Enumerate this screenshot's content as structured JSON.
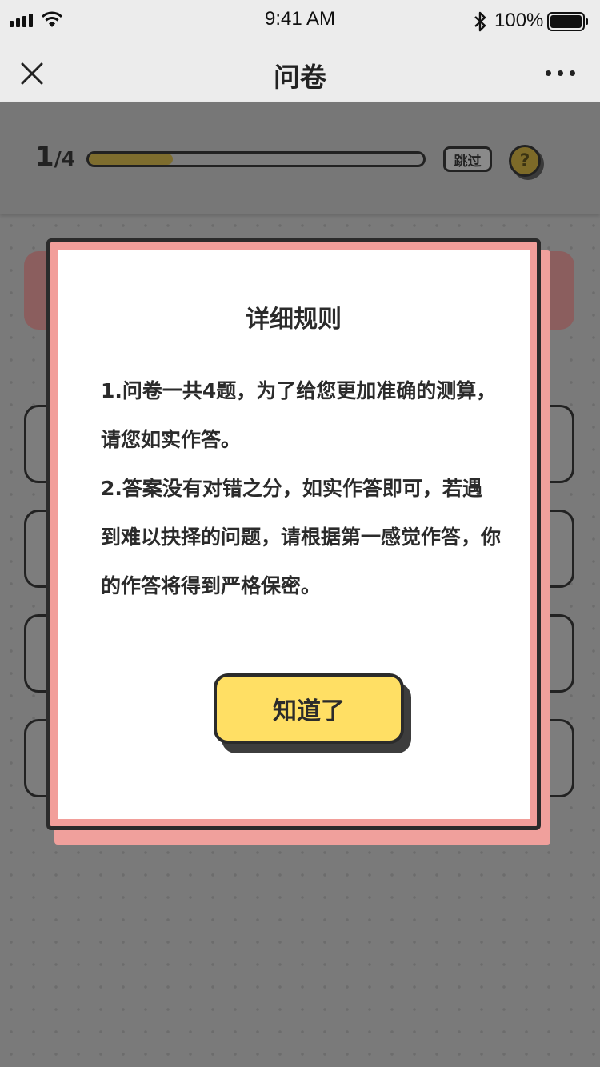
{
  "status_bar": {
    "time": "9:41 AM",
    "battery": "100%",
    "icons": [
      "signal-icon",
      "wifi-icon",
      "bluetooth-icon",
      "battery-icon"
    ]
  },
  "nav": {
    "title": "问卷",
    "close_icon": "close-icon",
    "more_icon": "more-icon"
  },
  "progress": {
    "current": "1",
    "total": "/4",
    "fraction": 0.25,
    "skip_label": "跳过",
    "help_label": "?"
  },
  "modal": {
    "title": "详细规则",
    "paragraphs": [
      "1.问卷一共4题，为了给您更加准确的测算，请您如实作答。",
      "2.答案没有对错之分，如实作答即可，若遇到难以抉择的问题，请根据第一感觉作答，你的作答将得到严格保密。"
    ],
    "confirm_label": "知道了"
  },
  "colors": {
    "overlay": "#7a7a7a",
    "modal_border": "#f29e9a",
    "button": "#ffdf64",
    "progress_fill": "#7e6d2e"
  }
}
